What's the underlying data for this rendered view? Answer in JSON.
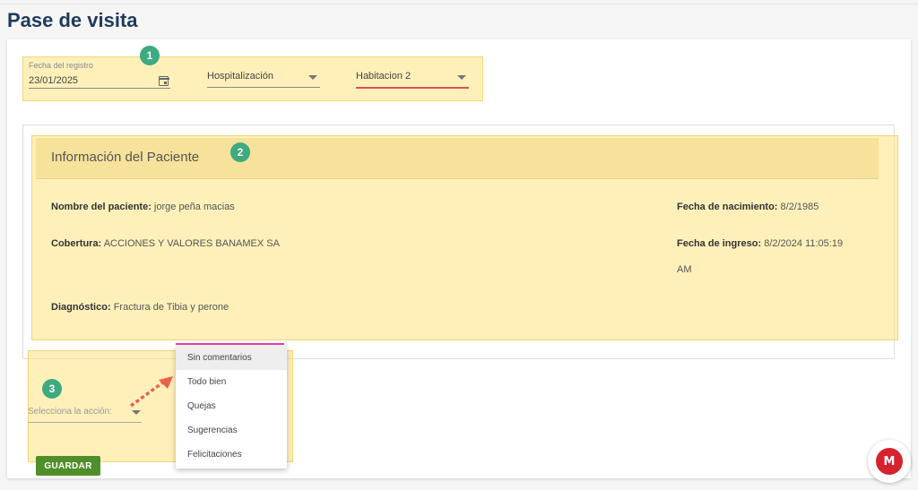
{
  "page": {
    "title": "Pase de visita"
  },
  "filters": {
    "fecha_label": "Fecha del registro",
    "fecha_value": "23/01/2025",
    "area_value": "Hospitalización",
    "habitacion_value": "Habitacion 2"
  },
  "badges": [
    "1",
    "2",
    "3"
  ],
  "patient": {
    "section_title": "Información del Paciente",
    "nombre_label": "Nombre del paciente:",
    "nombre_value": "jorge peña macias",
    "cobertura_label": "Cobertura:",
    "cobertura_value": "ACCIONES Y VALORES BANAMEX SA",
    "diagnostico_label": "Diagnóstico:",
    "diagnostico_value": "Fractura de Tibia y perone",
    "nacimiento_label": "Fecha de nacimiento:",
    "nacimiento_value": "8/2/1985",
    "ingreso_label": "Fecha de ingreso:",
    "ingreso_value": "8/2/2024 11:05:19",
    "ingreso_value_cont": "AM"
  },
  "action": {
    "placeholder": "Selecciona la acción:",
    "options": [
      "Sin comentarios",
      "Todo bien",
      "Quejas",
      "Sugerencias",
      "Felicitaciones"
    ]
  },
  "buttons": {
    "save_label": "GUARDAR",
    "fab_label": "M"
  },
  "colors": {
    "highlight": "#ffe482",
    "badge": "#3daa80",
    "title": "#1f3a5c",
    "save_button": "#4f8f2a",
    "fab": "#d6222f",
    "accent_underline": "#e0505a"
  }
}
